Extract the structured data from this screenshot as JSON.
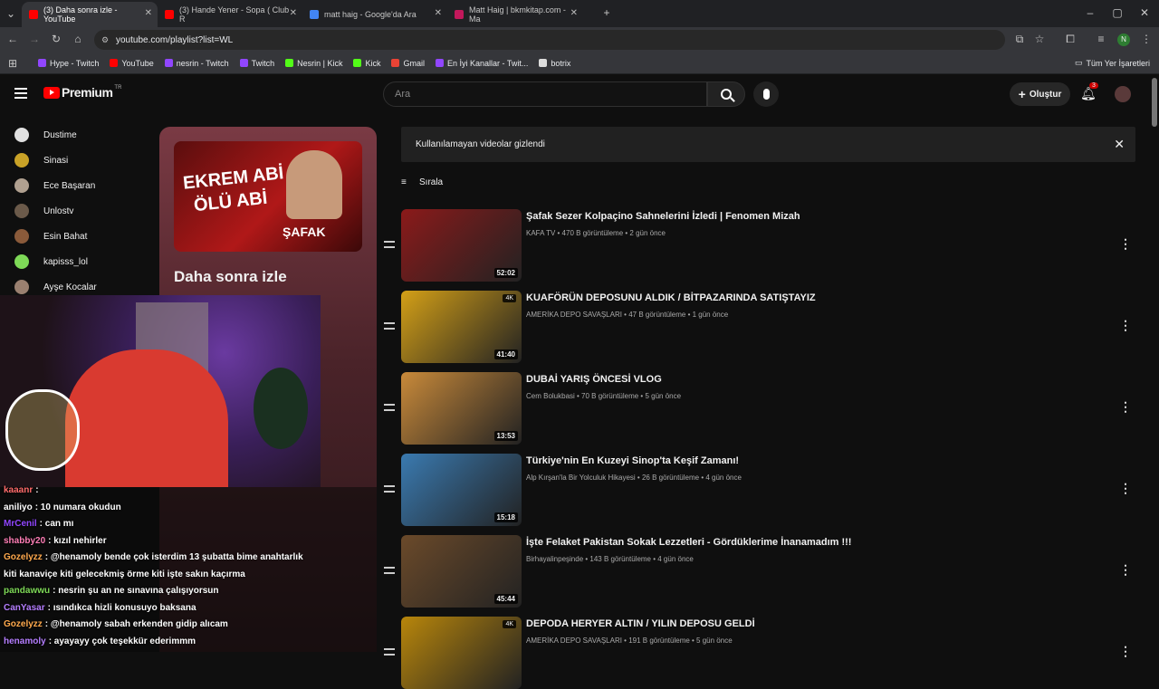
{
  "browser": {
    "tabs": [
      {
        "title": "(3) Daha sonra izle - YouTube",
        "color": "#ff0000"
      },
      {
        "title": "(3) Hande Yener - Sopa ( Club R",
        "color": "#ff0000"
      },
      {
        "title": "matt haig - Google'da Ara",
        "color": "#4285f4"
      },
      {
        "title": "Matt Haig | bkmkitap.com - Ma",
        "color": "#c2185b"
      }
    ],
    "url": "youtube.com/playlist?list=WL",
    "profile_initial": "N",
    "bookmarks": [
      {
        "label": "Hype - Twitch",
        "color": "#9146ff"
      },
      {
        "label": "YouTube",
        "color": "#ff0000"
      },
      {
        "label": "nesrin - Twitch",
        "color": "#9146ff"
      },
      {
        "label": "Twitch",
        "color": "#9146ff"
      },
      {
        "label": "Nesrin | Kick",
        "color": "#53fc18"
      },
      {
        "label": "Kick",
        "color": "#53fc18"
      },
      {
        "label": "Gmail",
        "color": "#ea4335"
      },
      {
        "label": "En İyi Kanallar - Twit...",
        "color": "#9146ff"
      },
      {
        "label": "botrix",
        "color": "#dddddd"
      }
    ],
    "all_bookmarks": "Tüm Yer İşaretleri"
  },
  "youtube": {
    "logo": "Premium",
    "region": "TR",
    "search_placeholder": "Ara",
    "create_label": "Oluştur",
    "notif_count": "3"
  },
  "sidebar": {
    "items": [
      {
        "label": "Dustime",
        "color": "#e0e0e0"
      },
      {
        "label": "Sinasi",
        "color": "#c9a227"
      },
      {
        "label": "Ece Başaran",
        "color": "#b0a090"
      },
      {
        "label": "Unlostv",
        "color": "#6b5a4a"
      },
      {
        "label": "Esin Bahat",
        "color": "#8a5a3a"
      },
      {
        "label": "kapisss_lol",
        "color": "#7ed957"
      },
      {
        "label": "Ayşe Kocalar",
        "color": "#9a8070"
      }
    ]
  },
  "playlist": {
    "title": "Daha sonra izle",
    "thumb_text_1": "EKREM ABİ",
    "thumb_text_2": "ÖLÜ ABİ",
    "thumb_text_3": "ŞAFAK"
  },
  "banner_text": "Kullanılamayan videolar gizlendi",
  "sort_label": "Sırala",
  "videos": [
    {
      "title": "Şafak Sezer Kolpaçino Sahnelerini İzledi | Fenomen Mizah",
      "meta": "KAFA TV • 470 B görüntüleme • 2 gün önce",
      "duration": "52:02",
      "quality": "",
      "thumb_color": "#8b1a1a"
    },
    {
      "title": "KUAFÖRÜN DEPOSUNU ALDIK / BİTPAZARINDA SATIŞTAYIZ",
      "meta": "AMERİKA DEPO SAVAŞLARI • 47 B görüntüleme • 1 gün önce",
      "duration": "41:40",
      "quality": "4K",
      "thumb_color": "#d4a017"
    },
    {
      "title": "DUBAİ YARIŞ ÖNCESİ VLOG",
      "meta": "Cem Bolukbasi • 70 B görüntüleme • 5 gün önce",
      "duration": "13:53",
      "quality": "",
      "thumb_color": "#c98a3a"
    },
    {
      "title": "Türkiye'nin En Kuzeyi Sinop'ta Keşif Zamanı!",
      "meta": "Alp Kırşan'la Bir Yolculuk Hikayesi • 26 B görüntüleme • 4 gün önce",
      "duration": "15:18",
      "quality": "",
      "thumb_color": "#3a7ab0"
    },
    {
      "title": "İşte Felaket Pakistan Sokak Lezzetleri - Gördüklerime İnanamadım !!!",
      "meta": "Birhayalinpeşinde • 143 B görüntüleme • 4 gün önce",
      "duration": "45:44",
      "quality": "",
      "thumb_color": "#6b4a2a"
    },
    {
      "title": "DEPODA HERYER ALTIN / YILIN DEPOSU GELDİ",
      "meta": "AMERİKA DEPO SAVAŞLARI • 191 B görüntüleme • 5 gün önce",
      "duration": "",
      "quality": "4K",
      "thumb_color": "#b8860b"
    }
  ],
  "chat": [
    {
      "user": "kaaanr",
      "text": ":",
      "color": "#ff6b6b"
    },
    {
      "user": "aniliyo",
      "text": ": 10 numara okudun",
      "color": "#ffffff"
    },
    {
      "user": "MrCenil",
      "text": ": can mı",
      "color": "#9146ff"
    },
    {
      "user": "shabby20",
      "text": ": kızıl nehirler",
      "color": "#ff7eb6"
    },
    {
      "user": "Gozelyzz",
      "text": ": @henamoly bende çok isterdim 13 şubatta bime anahtarlık",
      "color": "#ffa94d"
    },
    {
      "user": "",
      "text": "kiti kanaviçe kiti gelecekmiş örme kiti işte sakın kaçırma",
      "color": "#ffffff"
    },
    {
      "user": "pandawwu",
      "text": ": nesrin şu an ne sınavına çalışıyorsun",
      "color": "#7ed957"
    },
    {
      "user": "CanYasar",
      "text": ": ısındıkca hizli konusuyo baksana",
      "color": "#b57eff"
    },
    {
      "user": "Gozelyzz",
      "text": ": @henamoly sabah erkenden gidip alıcam",
      "color": "#ffa94d"
    },
    {
      "user": "henamoly",
      "text": ": ayayayy çok teşekkür ederimmm",
      "color": "#b57eff"
    }
  ]
}
